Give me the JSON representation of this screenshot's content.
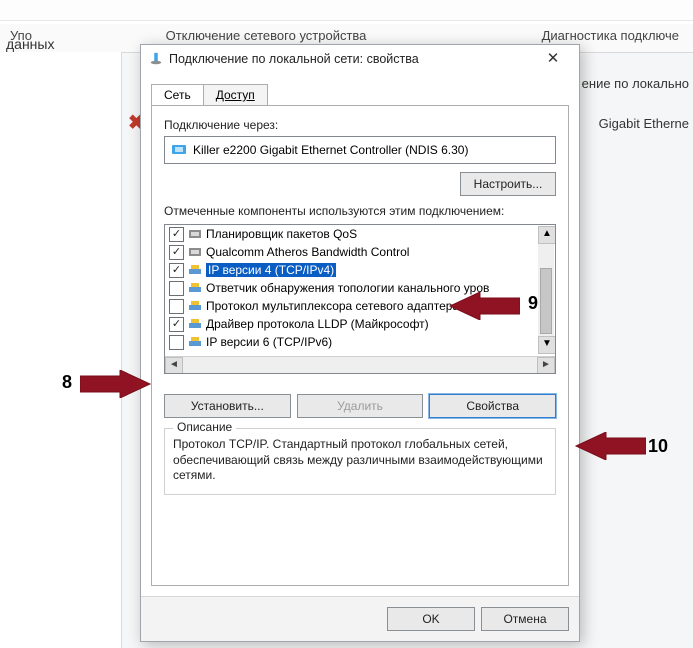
{
  "bg": {
    "sidebar_label": "данных",
    "menu_upor": "Упо",
    "menu_disable": "Отключение сетевого устройства",
    "menu_diag": "Диагностика подключе",
    "right1": "ение по локально",
    "right2": "Gigabit Etherne"
  },
  "dialog": {
    "title": "Подключение по локальной сети: свойства",
    "tabs": {
      "network": "Сеть",
      "access": "Доступ"
    },
    "connect_via_label": "Подключение через:",
    "adapter_name": "Killer e2200 Gigabit Ethernet Controller (NDIS 6.30)",
    "configure_btn": "Настроить...",
    "components_label": "Отмеченные компоненты используются этим подключением:",
    "items": [
      {
        "checked": true,
        "icon": "service",
        "text": "Планировщик пакетов QoS"
      },
      {
        "checked": true,
        "icon": "service",
        "text": "Qualcomm Atheros Bandwidth Control"
      },
      {
        "checked": true,
        "icon": "proto",
        "text": "IP версии 4 (TCP/IPv4)",
        "selected": true
      },
      {
        "checked": false,
        "icon": "proto",
        "text": "Ответчик обнаружения топологии канального уров"
      },
      {
        "checked": false,
        "icon": "proto",
        "text": "Протокол мультиплексора сетевого адаптера (Ма"
      },
      {
        "checked": true,
        "icon": "proto",
        "text": "Драйвер протокола LLDP (Майкрософт)"
      },
      {
        "checked": false,
        "icon": "proto",
        "text": "IP версии 6 (TCP/IPv6)"
      }
    ],
    "install_btn": "Установить...",
    "remove_btn": "Удалить",
    "properties_btn": "Свойства",
    "desc_group": "Описание",
    "desc_text": "Протокол TCP/IP. Стандартный протокол глобальных сетей, обеспечивающий связь между различными взаимодействующими сетями.",
    "ok_btn": "OK",
    "cancel_btn": "Отмена"
  },
  "annotations": {
    "n8": "8",
    "n9": "9",
    "n10": "10"
  }
}
